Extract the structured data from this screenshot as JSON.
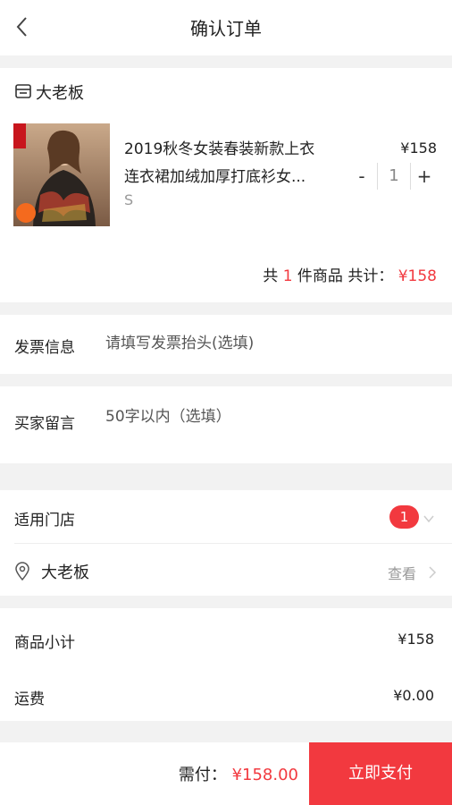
{
  "header": {
    "title": "确认订单"
  },
  "store": {
    "name": "大老板"
  },
  "product": {
    "title_line1": "2019秋冬女装春装新款上衣",
    "title_line2": "连衣裙加绒加厚打底衫女...",
    "spec": "S",
    "price": "¥158",
    "stepper": {
      "minus": "-",
      "quantity": "1",
      "plus": "+"
    }
  },
  "summary": {
    "prefix": "共",
    "count": "1",
    "middle": "件商品  共计：",
    "total": "¥158"
  },
  "invoice": {
    "label": "发票信息",
    "placeholder": "请填写发票抬头(选填)"
  },
  "message": {
    "label": "买家留言",
    "placeholder": "50字以内（选填）"
  },
  "store_section": {
    "label": "适用门店",
    "badge_count": "1",
    "store_name": "大老板",
    "view_label": "查看"
  },
  "totals": {
    "subtotal_label": "商品小计",
    "subtotal_value": "¥158",
    "shipping_label": "运费",
    "shipping_value": "¥0.00"
  },
  "bottom_bar": {
    "due_label": "需付：",
    "due_amount": "¥158.00",
    "pay_label": "立即支付"
  },
  "colors": {
    "accent": "#f2393f",
    "background": "#f2f2f2"
  }
}
